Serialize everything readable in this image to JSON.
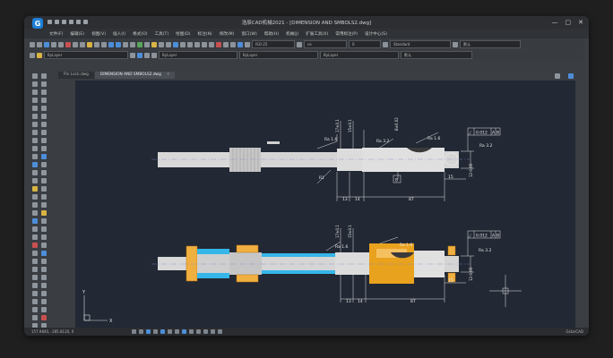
{
  "window": {
    "title": "浩辰CAD机械2021 - [DIMENSION AND SMBOLS2.dwg]",
    "logo_letter": "G",
    "controls": [
      "—",
      "▢",
      "✕"
    ]
  },
  "menu": [
    "文件(F)",
    "编辑(E)",
    "视图(V)",
    "插入(I)",
    "格式(O)",
    "工具(T)",
    "绘图(D)",
    "标注(N)",
    "修改(M)",
    "窗口(W)",
    "帮助(H)",
    "机械(J)",
    "扩展工具(X)",
    "常用标注(P)",
    "设计中心(S)"
  ],
  "toolbar": {
    "layer_label": "0",
    "layer2_label": "ByLayer",
    "dim_style": "ISO-25",
    "lineweight": "ByLayer",
    "linetype": "ByLayer",
    "text_style": "Standard",
    "plot_style": "默认",
    "font": "ce",
    "color_label": "ByLayer"
  },
  "tabs": [
    {
      "label": "Pin Lock.dwg",
      "active": false
    },
    {
      "label": "DIMENSION AND SMBOLS2.dwg",
      "active": true
    }
  ],
  "layout_tabs": [
    "模型",
    "Layout1",
    "Layout2"
  ],
  "status": {
    "coords": "157.9840, -285.8120, 0",
    "app_name": "GstarCAD"
  },
  "colors": {
    "canvas": "#222834",
    "accent": "#1e7fd6",
    "highlight_orange": "#e8a21e",
    "highlight_cyan": "#35b6e8"
  },
  "drawing": {
    "top": {
      "roughness": [
        "Ra 1.6",
        "Ra 3.2",
        "Ra 1.6",
        "Ra 3.2"
      ],
      "verticals": [
        "17±0.1",
        "15±0.1",
        "8±0.02"
      ],
      "tolerance_symbol": "⌰",
      "tolerance_value": "0.012",
      "datum": "A",
      "datum2": "B",
      "datum_bottom": "B",
      "radius": "R1",
      "dims_bottom": [
        "13",
        "14",
        "87"
      ],
      "dim_right": "15",
      "dim_right_v": "12-0.05"
    },
    "bottom": {
      "roughness": [
        "Ra 1.6",
        "Ra 1.6",
        "Ra 3.2"
      ],
      "verticals": [
        "17±0.1",
        "15±0.1"
      ],
      "tolerance_symbol": "⌰",
      "tolerance_value": "0.012",
      "datum": "A",
      "datum2": "B",
      "dims_bottom": [
        "13",
        "14",
        "87"
      ],
      "dim_right": "15",
      "dim_right_v": "12-0.05"
    },
    "ucs_y": "Y",
    "ucs_x": "X"
  }
}
